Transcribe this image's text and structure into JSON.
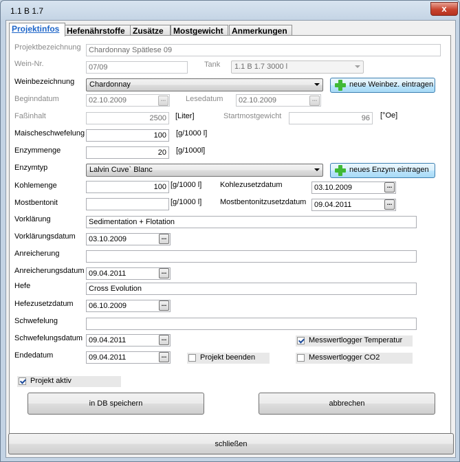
{
  "window": {
    "title": "1.1 B 1.7",
    "close_label": "x"
  },
  "tabs": [
    {
      "label": "Projektinfos"
    },
    {
      "label": "Hefenährstoffe"
    },
    {
      "label": "Zusätze"
    },
    {
      "label": "Mostgewicht"
    },
    {
      "label": "Anmerkungen"
    }
  ],
  "form": {
    "projektbezeichnung": {
      "label": "Projektbezeichnung",
      "value": "Chardonnay Spätlese 09"
    },
    "wein_nr": {
      "label": "Wein-Nr.",
      "value": "07/09"
    },
    "tank": {
      "label": "Tank",
      "value": "1.1 B 1.7   3000 l"
    },
    "weinbezeichnung": {
      "label": "Weinbezeichnung",
      "value": "Chardonnay",
      "button": "neue Weinbez. eintragen"
    },
    "beginndatum": {
      "label": "Beginndatum",
      "value": "02.10.2009"
    },
    "lesedatum": {
      "label": "Lesedatum",
      "value": "02.10.2009"
    },
    "fassinhalt": {
      "label": "Faßinhalt",
      "value": "2500",
      "unit": "[Liter]"
    },
    "startmostgewicht": {
      "label": "Startmostgewicht",
      "value": "96",
      "unit": "[°Oe]"
    },
    "maischeschwefelung": {
      "label": "Maischeschwefelung",
      "value": "100",
      "unit": "[g/1000 l]"
    },
    "enzymmenge": {
      "label": "Enzymmenge",
      "value": "20",
      "unit": "[g/1000l]"
    },
    "enzymtyp": {
      "label": "Enzymtyp",
      "value": "Lalvin Cuve` Blanc",
      "button": "neues Enzym eintragen"
    },
    "kohlemenge": {
      "label": "Kohlemenge",
      "value": "100",
      "unit": "[g/1000 l]"
    },
    "kohlezusetzdatum": {
      "label": "Kohlezusetzdatum",
      "value": "03.10.2009"
    },
    "mostbentonit": {
      "label": "Mostbentonit",
      "value": "",
      "unit": "[g/1000 l]"
    },
    "mostbentonitzusetzdatum": {
      "label": "Mostbentonitzusetzdatum",
      "value": "09.04.2011"
    },
    "vorklaerung": {
      "label": "Vorklärung",
      "value": "Sedimentation + Flotation"
    },
    "vorklaerungsdatum": {
      "label": "Vorklärungsdatum",
      "value": "03.10.2009"
    },
    "anreicherung": {
      "label": "Anreicherung",
      "value": ""
    },
    "anreicherungsdatum": {
      "label": "Anreicherungsdatum",
      "value": "09.04.2011"
    },
    "hefe": {
      "label": "Hefe",
      "value": "Cross Evolution"
    },
    "hefezusetzdatum": {
      "label": "Hefezusetzdatum",
      "value": "06.10.2009"
    },
    "schwefelung": {
      "label": "Schwefelung",
      "value": ""
    },
    "schwefelungsdatum": {
      "label": "Schwefelungsdatum",
      "value": "09.04.2011"
    },
    "endedatum": {
      "label": "Endedatum",
      "value": "09.04.2011"
    },
    "projekt_beenden": {
      "label": "Projekt beenden",
      "checked": false
    },
    "messwertlogger_temperatur": {
      "label": "Messwertlogger Temperatur",
      "checked": true
    },
    "messwertlogger_co2": {
      "label": "Messwertlogger CO2",
      "checked": false
    },
    "projekt_aktiv": {
      "label": "Projekt aktiv",
      "checked": true
    },
    "dot_label": "..."
  },
  "actions": {
    "save": "in DB speichern",
    "cancel": "abbrechen",
    "close": "schließen"
  }
}
